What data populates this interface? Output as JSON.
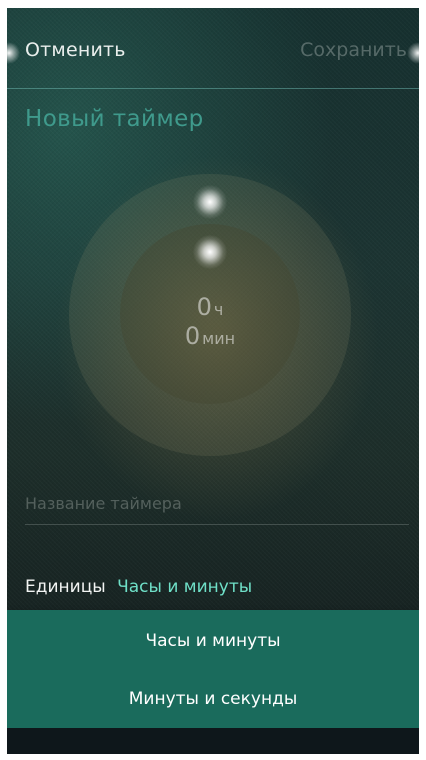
{
  "header": {
    "cancel_label": "Отменить",
    "save_label": "Сохранить"
  },
  "page": {
    "title": "Новый таймер"
  },
  "dial": {
    "hours_value": "0",
    "hours_unit": "ч",
    "minutes_value": "0",
    "minutes_unit": "мин"
  },
  "timer_name": {
    "value": "",
    "placeholder": "Название таймера"
  },
  "units": {
    "label": "Единицы",
    "selected": "Часы и минуты",
    "options": [
      "Часы и минуты",
      "Минуты и секунды"
    ]
  },
  "colors": {
    "accent": "#6fe0c8",
    "title": "#3f9a8c",
    "dropdown_bg": "#1a6b5c"
  }
}
